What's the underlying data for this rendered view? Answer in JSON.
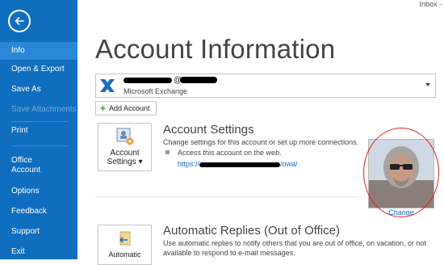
{
  "window": {
    "title": "Inbox - C"
  },
  "sidebar": {
    "items": [
      {
        "label": "Info",
        "state": "active"
      },
      {
        "label": "Open & Export",
        "state": "normal"
      },
      {
        "label": "Save As",
        "state": "normal"
      },
      {
        "label": "Save Attachments",
        "state": "disabled"
      },
      {
        "label": "Print",
        "state": "normal"
      },
      {
        "label": "Office Account",
        "state": "normal"
      },
      {
        "label": "Options",
        "state": "normal"
      },
      {
        "label": "Feedback",
        "state": "normal"
      },
      {
        "label": "Support",
        "state": "normal"
      },
      {
        "label": "Exit",
        "state": "normal"
      }
    ],
    "accent": "#106ebe"
  },
  "page": {
    "title": "Account Information"
  },
  "account": {
    "email_visible": "@",
    "type": "Microsoft Exchange",
    "icon": "exchange-icon"
  },
  "add_account": {
    "label": "Add Account"
  },
  "account_settings": {
    "tile_label_line1": "Account",
    "tile_label_line2": "Settings ▾",
    "title": "Account Settings",
    "description": "Change settings for this account or set up more connections.",
    "bullet": "Access this account on the web.",
    "link_prefix": "https://",
    "link_suffix": "/owa/"
  },
  "profile": {
    "change_label": "Change"
  },
  "auto_replies": {
    "tile_label": "Automatic",
    "title": "Automatic Replies (Out of Office)",
    "description_line1": "Use automatic replies to notify others that you are out of office, on vacation, or not",
    "description_line2": "available to respond to e-mail messages."
  }
}
